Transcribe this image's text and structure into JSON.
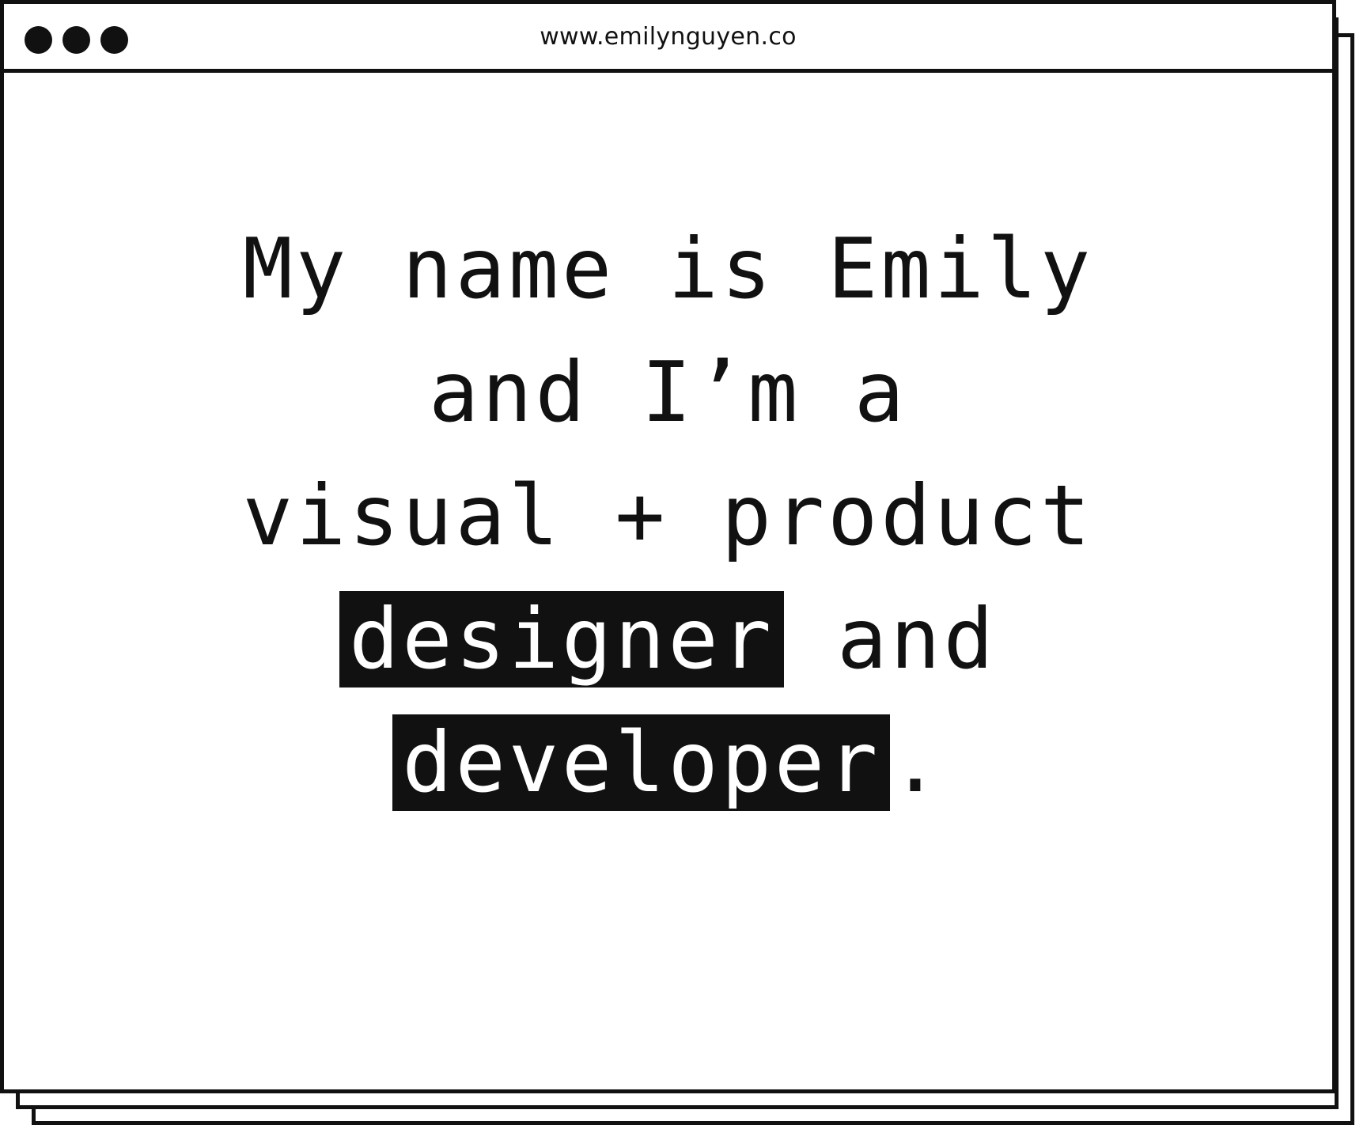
{
  "browser": {
    "url": "www.emilynguyen.co",
    "window_controls": [
      "dot-1",
      "dot-2",
      "dot-3"
    ]
  },
  "hero": {
    "line1": "My name is Emily",
    "line2": "and I’m a",
    "line3": "visual + product",
    "line4_highlight": "designer",
    "line4_rest": " and",
    "line5_highlight": "developer",
    "line5_rest": "."
  },
  "colors": {
    "ink": "#111111",
    "paper": "#ffffff"
  }
}
